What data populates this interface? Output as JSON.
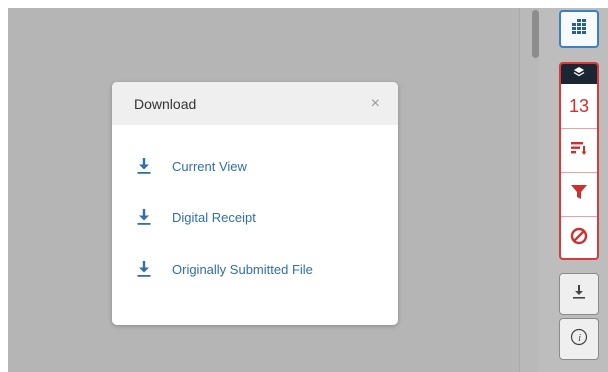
{
  "modal": {
    "title": "Download",
    "close_label": "×",
    "options": [
      {
        "label": "Current View"
      },
      {
        "label": "Digital Receipt"
      },
      {
        "label": "Originally Submitted File"
      }
    ]
  },
  "toolbar": {
    "filter_count": "13",
    "icons": [
      "grid-icon",
      "layers-icon",
      "sort-icon",
      "filter-icon",
      "clear-filter-icon",
      "download-icon",
      "info-icon"
    ]
  },
  "colors": {
    "accent_blue": "#2f6fad",
    "alert_red": "#cf2f2f",
    "overlay_gray": "#b5b5b5",
    "header_gray": "#efefef"
  }
}
